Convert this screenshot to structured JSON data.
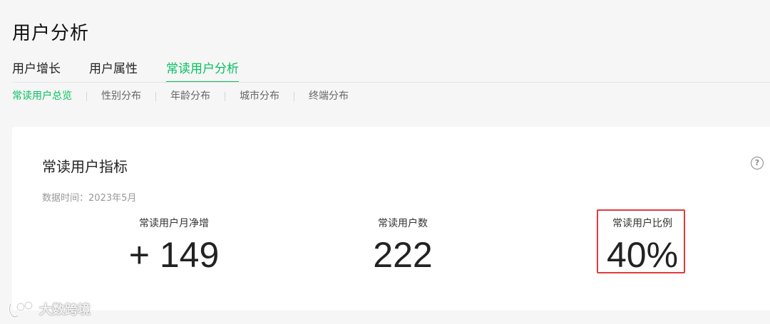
{
  "page": {
    "title": "用户分析"
  },
  "tabs": [
    {
      "label": "用户增长"
    },
    {
      "label": "用户属性"
    },
    {
      "label": "常读用户分析",
      "active": true
    }
  ],
  "subnav": [
    {
      "label": "常读用户总览",
      "active": true
    },
    {
      "label": "性别分布"
    },
    {
      "label": "年龄分布"
    },
    {
      "label": "城市分布"
    },
    {
      "label": "终端分布"
    }
  ],
  "card": {
    "title": "常读用户指标",
    "help_icon": "question-circle-icon",
    "data_time": "数据时间：2023年5月",
    "metrics": [
      {
        "label": "常读用户月净增",
        "value": "+ 149"
      },
      {
        "label": "常读用户数",
        "value": "222"
      },
      {
        "label": "常读用户比例",
        "value": "40%"
      }
    ]
  },
  "watermark": {
    "text": "大数跨境"
  },
  "colors": {
    "accent": "#07c160",
    "highlight": "#e03a3a",
    "background": "#f6f6f6"
  }
}
